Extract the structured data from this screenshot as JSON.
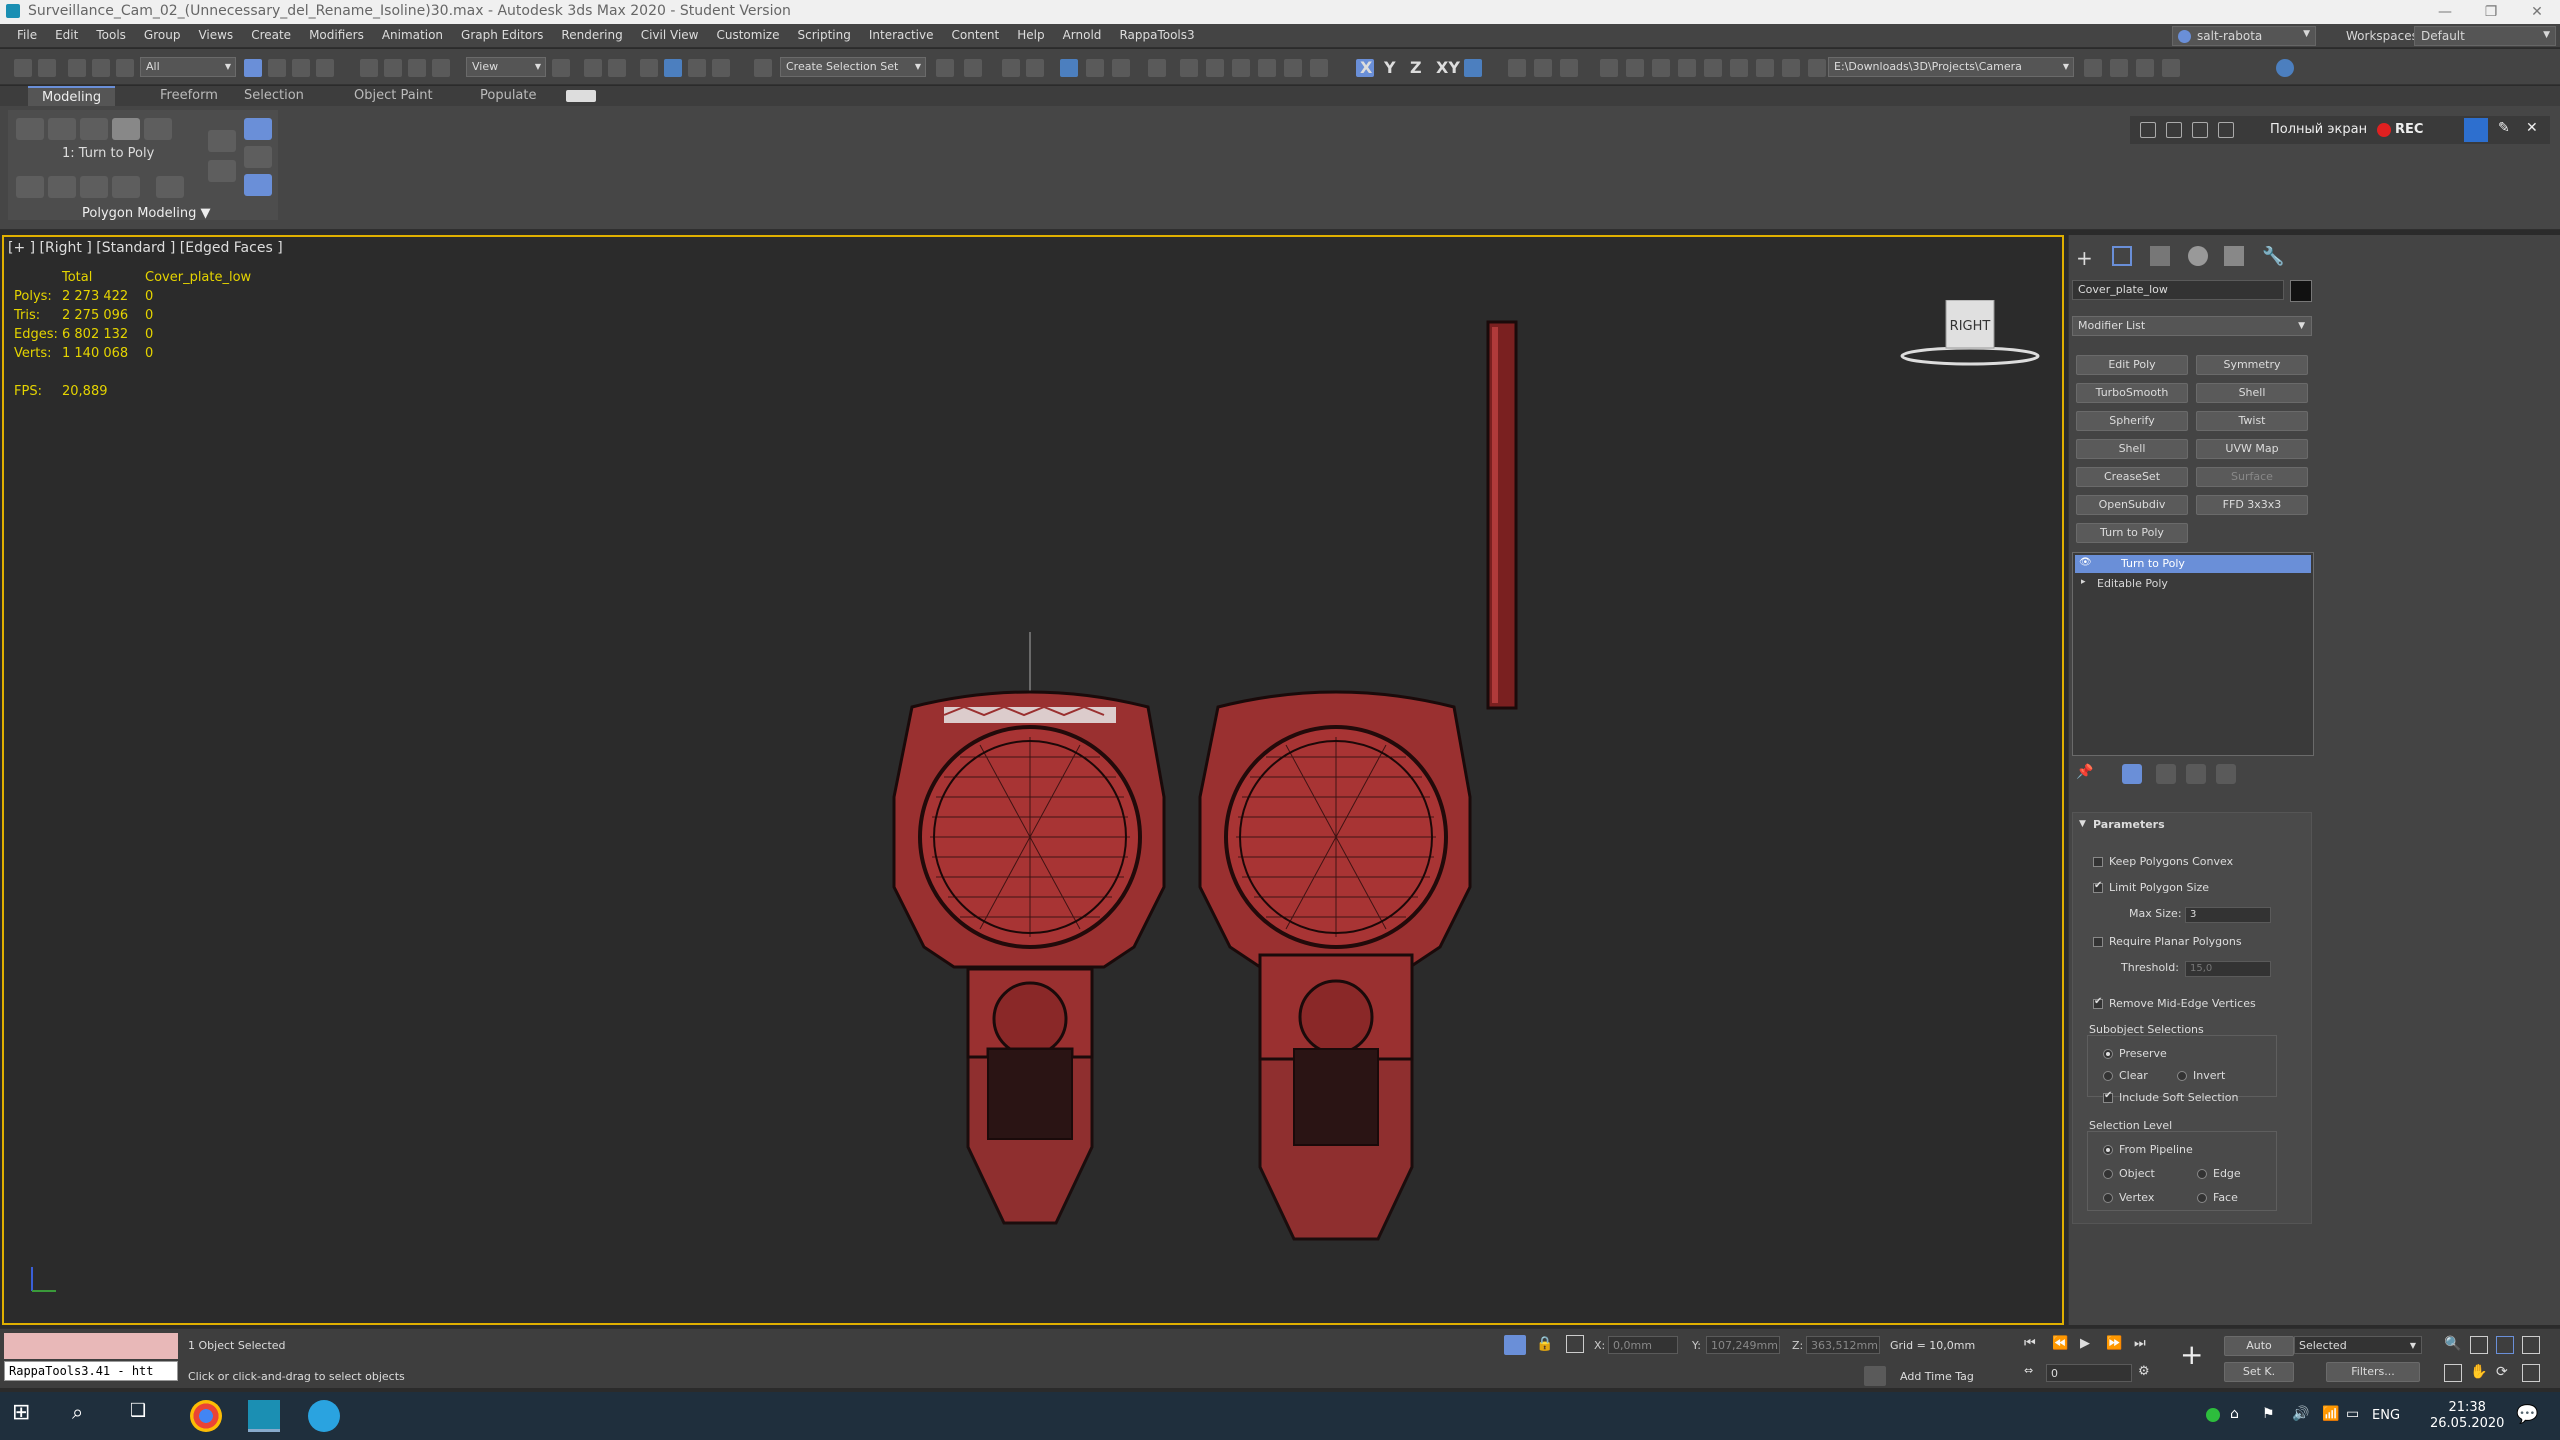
{
  "window": {
    "title": "Surveillance_Cam_02_(Unnecessary_del_Rename_Isoline)30.max - Autodesk 3ds Max 2020 - Student Version"
  },
  "menu": {
    "items": [
      "File",
      "Edit",
      "Tools",
      "Group",
      "Views",
      "Create",
      "Modifiers",
      "Animation",
      "Graph Editors",
      "Rendering",
      "Civil View",
      "Customize",
      "Scripting",
      "Interactive",
      "Content",
      "Help",
      "Arnold",
      "RappaTools3"
    ],
    "user": "salt-rabota",
    "workspaces_label": "Workspaces:",
    "workspace": "Default"
  },
  "toolbar": {
    "filter": "All",
    "ref_coord": "View",
    "selection_set": "Create Selection Set",
    "axis_x": "X",
    "axis_y": "Y",
    "axis_z": "Z",
    "axis_xy": "XY",
    "path": "E:\\Downloads\\3D\\Projects\\Camera"
  },
  "ribbon": {
    "tabs": [
      "Modeling",
      "Freeform",
      "Selection",
      "Object Paint",
      "Populate"
    ],
    "modifier_label": "1: Turn to Poly",
    "panel_label": "Polygon Modeling",
    "fullscreen": "Полный экран",
    "rec": "REC"
  },
  "viewport": {
    "label": "[+ ] [Right ] [Standard ] [Edged Faces ]",
    "viewcube": "RIGHT",
    "stats": {
      "header_total": "Total",
      "header_object": "Cover_plate_low",
      "rows": [
        {
          "label": "Polys:",
          "total": "2 273 422",
          "obj": "0"
        },
        {
          "label": "Tris:",
          "total": "2 275 096",
          "obj": "0"
        },
        {
          "label": "Edges:",
          "total": "6 802 132",
          "obj": "0"
        },
        {
          "label": "Verts:",
          "total": "1 140 068",
          "obj": "0"
        }
      ],
      "fps_label": "FPS:",
      "fps": "20,889"
    }
  },
  "command_panel": {
    "object_name": "Cover_plate_low",
    "modifier_list": "Modifier List",
    "buttons": [
      [
        "Edit Poly",
        "Symmetry"
      ],
      [
        "TurboSmooth",
        "Shell"
      ],
      [
        "Spherify",
        "Twist"
      ],
      [
        "Shell",
        "UVW Map"
      ],
      [
        "CreaseSet",
        "Surface"
      ],
      [
        "OpenSubdiv",
        "FFD 3x3x3"
      ],
      [
        "Turn to Poly",
        ""
      ]
    ],
    "stack": [
      "Turn to Poly",
      "Editable Poly"
    ],
    "params": {
      "title": "Parameters",
      "keep_convex": "Keep Polygons Convex",
      "limit_size": "Limit Polygon Size",
      "max_size_label": "Max Size:",
      "max_size": "3",
      "require_planar": "Require Planar Polygons",
      "threshold_label": "Threshold:",
      "threshold": "15,0",
      "remove_mid": "Remove Mid-Edge Vertices",
      "subobj_title": "Subobject Selections",
      "preserve": "Preserve",
      "clear": "Clear",
      "invert": "Invert",
      "include_soft": "Include Soft Selection",
      "sel_level_title": "Selection Level",
      "from_pipeline": "From Pipeline",
      "object": "Object",
      "edge": "Edge",
      "vertex": "Vertex",
      "face": "Face"
    }
  },
  "status": {
    "maxscript": "RappaTools3.41 - htt",
    "selected": "1 Object Selected",
    "prompt": "Click or click-and-drag to select objects",
    "x_label": "X:",
    "x": "0,0mm",
    "y_label": "Y:",
    "y": "107,249mm",
    "z_label": "Z:",
    "z": "363,512mm",
    "grid": "Grid = 10,0mm",
    "add_time_tag": "Add Time Tag",
    "auto": "Auto",
    "setk": "Set K.",
    "selected_dd": "Selected",
    "filters": "Filters...",
    "frame": "0"
  },
  "taskbar": {
    "lang": "ENG",
    "time": "21:38",
    "date": "26.05.2020"
  },
  "colors": {
    "accent": "#6a8fd8",
    "viewport_border": "#e0b000",
    "mesh": "#b03a3a",
    "stats": "#e5d400"
  }
}
